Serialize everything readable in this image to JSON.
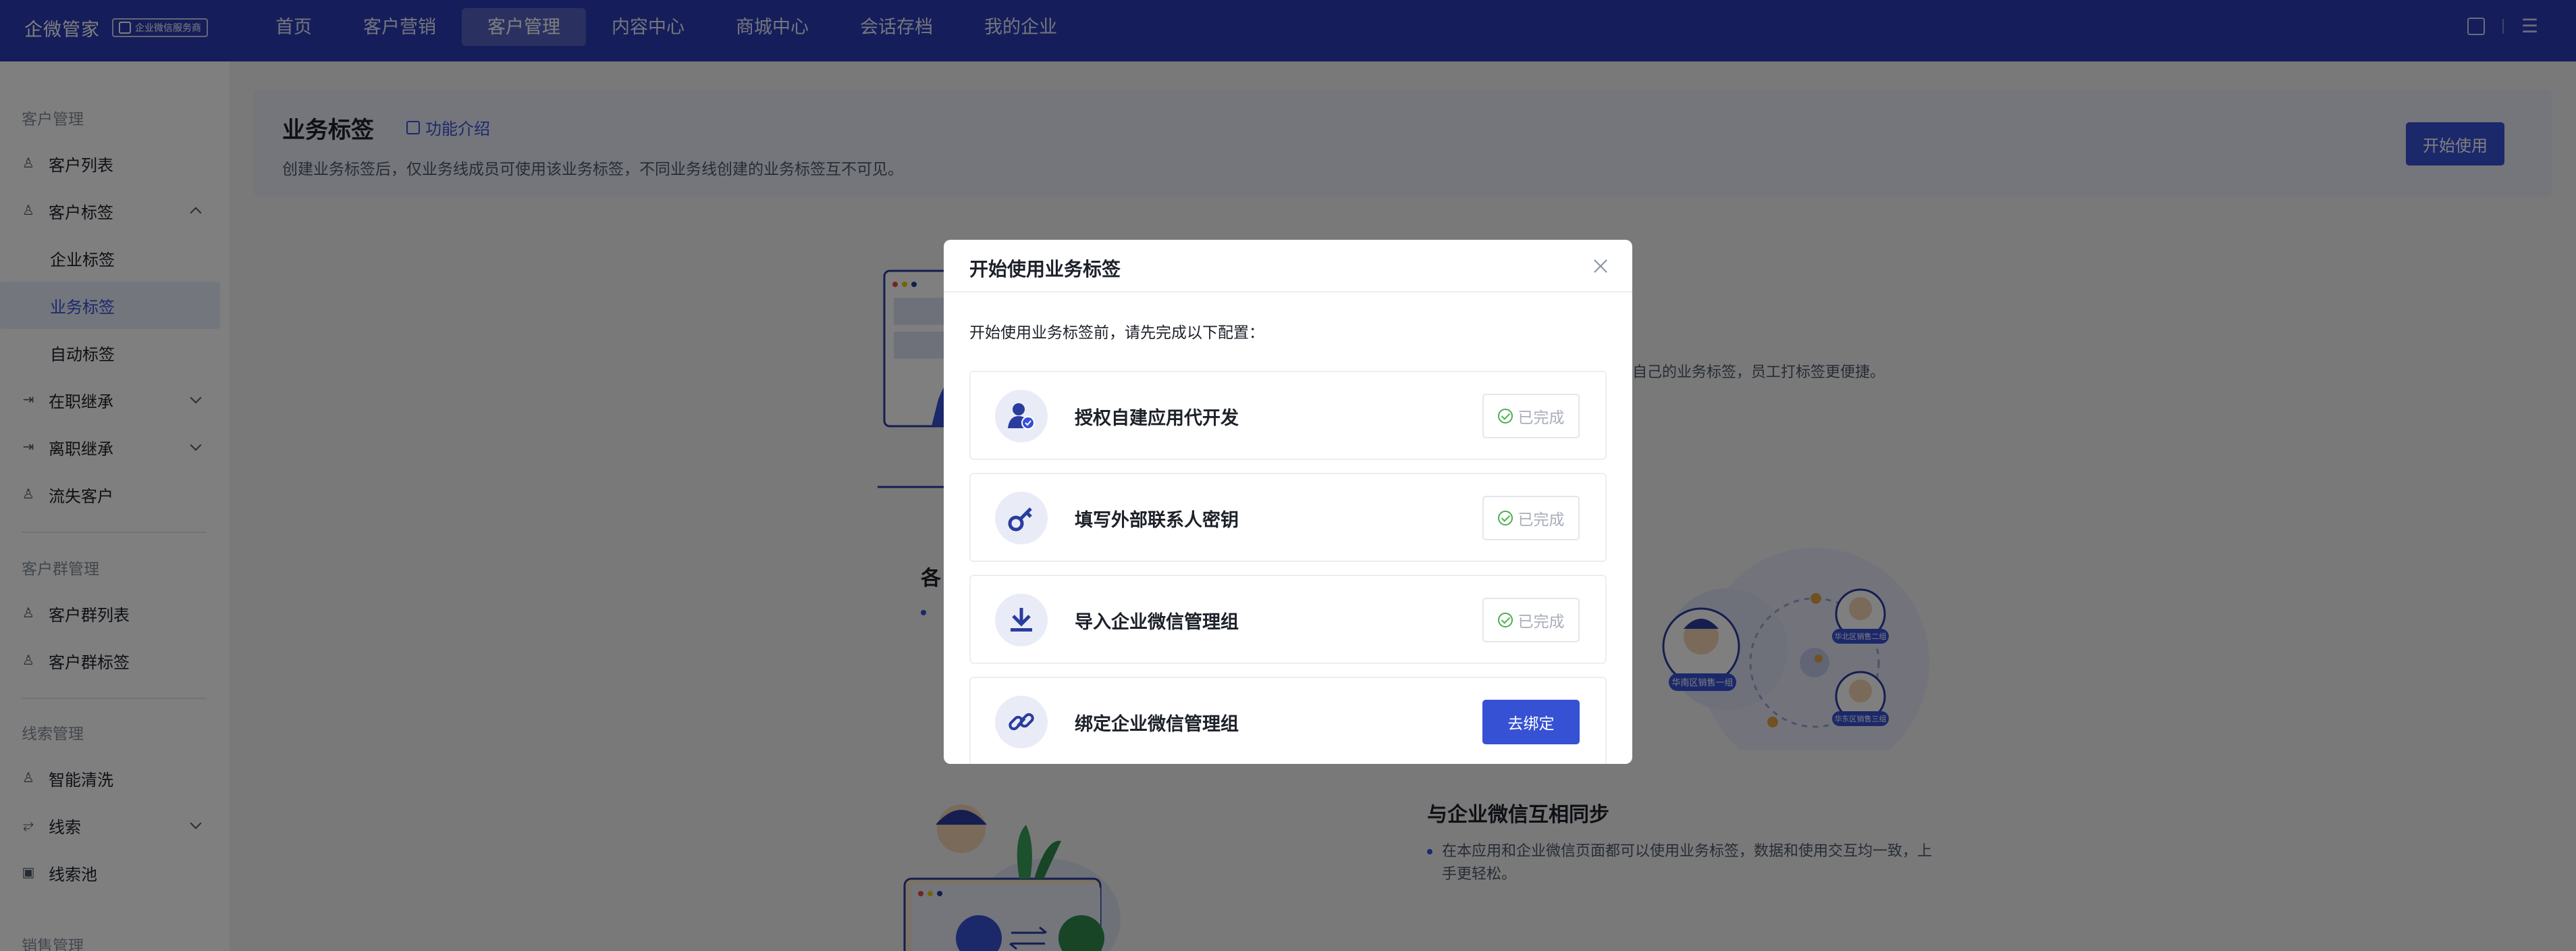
{
  "app": {
    "brand": "企微管家",
    "badge": "企业微信服务商"
  },
  "nav": {
    "items": [
      {
        "label": "首页"
      },
      {
        "label": "客户营销"
      },
      {
        "label": "客户管理",
        "active": true
      },
      {
        "label": "内容中心"
      },
      {
        "label": "商城中心"
      },
      {
        "label": "会话存档"
      },
      {
        "label": "我的企业"
      }
    ]
  },
  "sidebar": {
    "group_customer": "客户管理",
    "customer_list": "客户列表",
    "customer_tags": "客户标签",
    "enterprise_tags": "企业标签",
    "business_tags": "业务标签",
    "auto_tags": "自动标签",
    "onjob_inherit": "在职继承",
    "resign_inherit": "离职继承",
    "lost_customers": "流失客户",
    "group_customer_groups": "客户群管理",
    "customer_group_list": "客户群列表",
    "customer_group_tags": "客户群标签",
    "group_leads": "线索管理",
    "smart_clean": "智能清洗",
    "leads": "线索",
    "leads_pool": "线索池",
    "group_sales": "销售管理"
  },
  "banner": {
    "title": "业务标签",
    "link": "功能介绍",
    "desc": "创建业务标签后，仅业务线成员可使用该业务标签，不同业务线创建的业务标签互不可见。",
    "button": "开始使用"
  },
  "content": {
    "partial_right_text": "自己的业务标签，员工打标签更便捷。",
    "partial_left_title": "各",
    "sync_title": "与企业微信互相同步",
    "sync_desc_line1": "在本应用和企业微信页面都可以使用业务标签，数据和使用交互均一致，上",
    "sync_desc_line2": "手更轻松。",
    "illus_tag_1": "华南区销售一组",
    "illus_tag_2": "华北区销售二组",
    "illus_tag_3": "华东区销售三组"
  },
  "modal": {
    "title": "开始使用业务标签",
    "intro": "开始使用业务标签前，请先完成以下配置：",
    "steps": [
      {
        "label": "授权自建应用代开发",
        "status": "已完成",
        "icon": "user-check-icon"
      },
      {
        "label": "填写外部联系人密钥",
        "status": "已完成",
        "icon": "key-icon"
      },
      {
        "label": "导入企业微信管理组",
        "status": "已完成",
        "icon": "download-icon"
      },
      {
        "label": "绑定企业微信管理组",
        "action": "去绑定",
        "icon": "link-icon"
      }
    ]
  },
  "colors": {
    "primary": "#3651d4",
    "topbar": "#2a3cb5",
    "success": "#4caf50"
  }
}
